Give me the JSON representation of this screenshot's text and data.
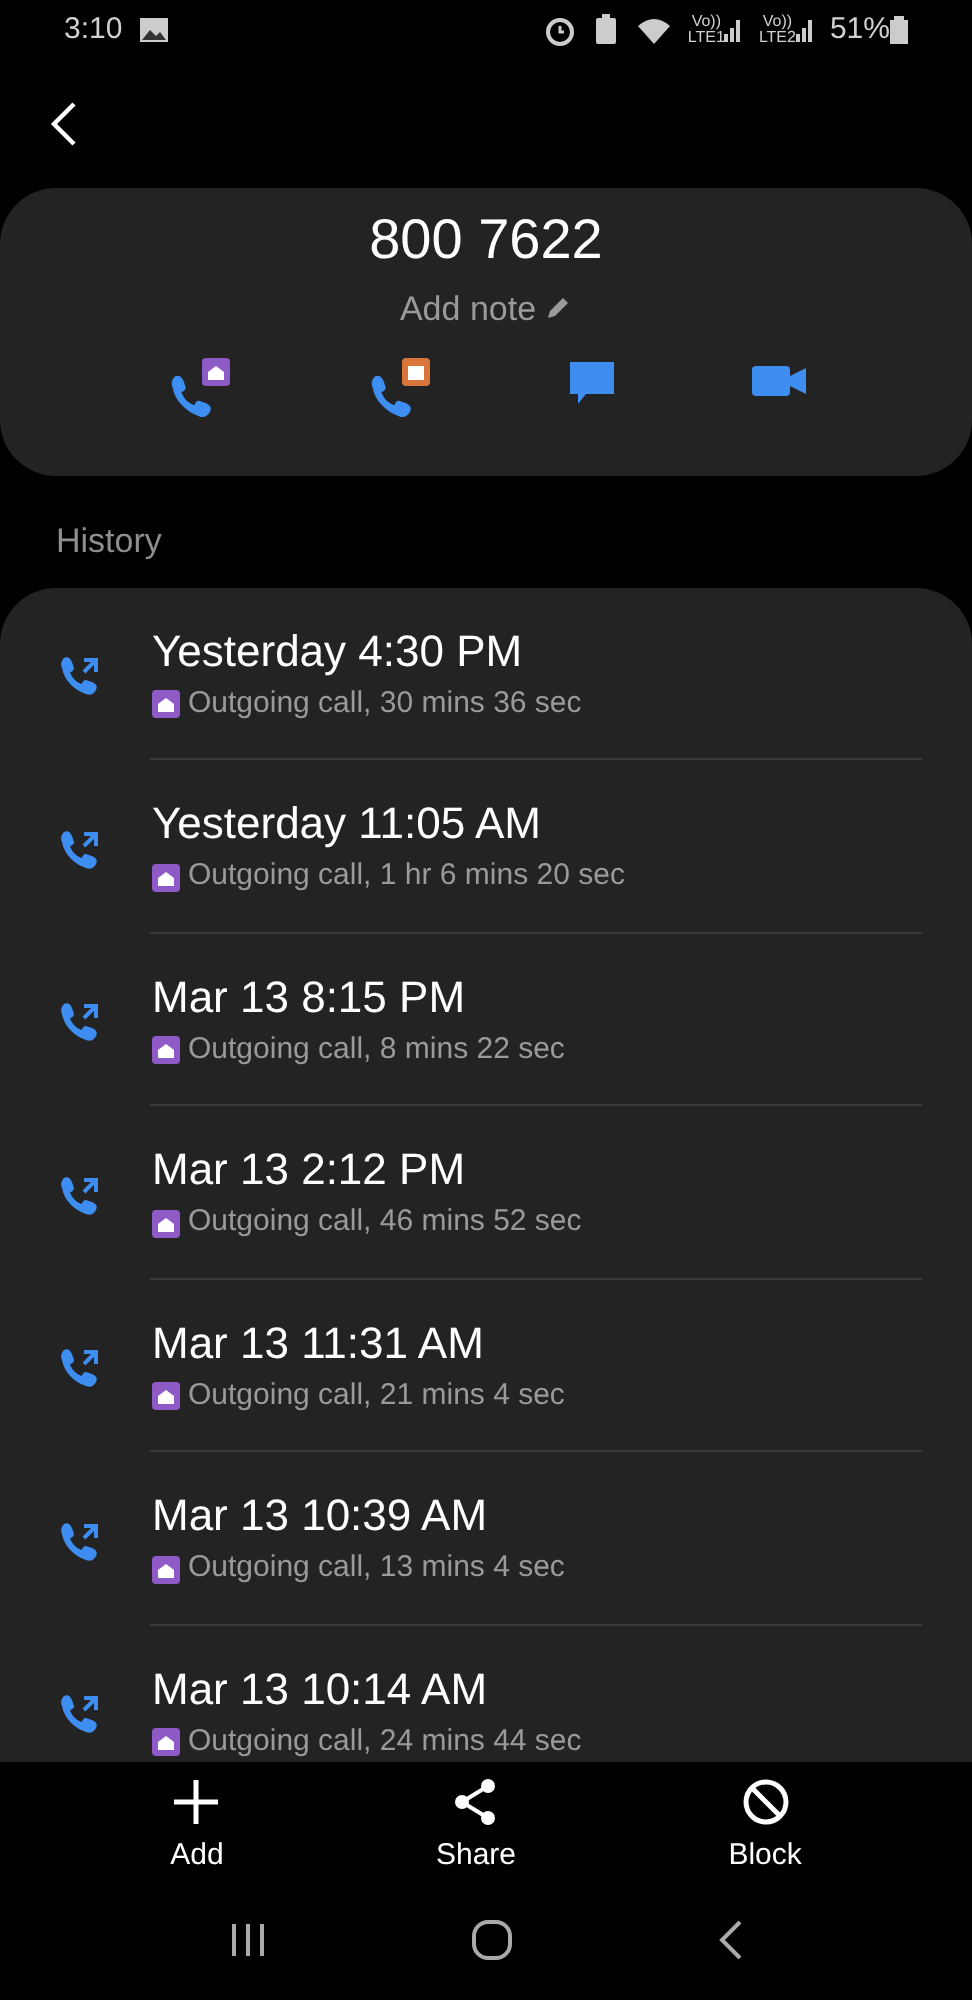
{
  "status_bar": {
    "time": "3:10",
    "sims": [
      {
        "volte": "Vo))",
        "network": "LTE1"
      },
      {
        "volte": "Vo))",
        "network": "LTE2"
      }
    ],
    "battery": "51%"
  },
  "contact": {
    "number": "800 7622",
    "note_placeholder": "Add note"
  },
  "actions": [
    {
      "kind": "call_home"
    },
    {
      "kind": "call_work"
    },
    {
      "kind": "message"
    },
    {
      "kind": "video"
    }
  ],
  "history": {
    "title": "History",
    "rows": [
      {
        "time": "Yesterday 4:30 PM",
        "detail": "Outgoing call, 30 mins 36 sec"
      },
      {
        "time": "Yesterday 11:05 AM",
        "detail": "Outgoing call, 1 hr 6 mins 20 sec"
      },
      {
        "time": "Mar 13 8:15 PM",
        "detail": "Outgoing call, 8 mins 22 sec"
      },
      {
        "time": "Mar 13 2:12 PM",
        "detail": "Outgoing call, 46 mins 52 sec"
      },
      {
        "time": "Mar 13 11:31 AM",
        "detail": "Outgoing call, 21 mins 4 sec"
      },
      {
        "time": "Mar 13 10:39 AM",
        "detail": "Outgoing call, 13 mins 4 sec"
      },
      {
        "time": "Mar 13 10:14 AM",
        "detail": "Outgoing call, 24 mins 44 sec"
      }
    ]
  },
  "bottom_actions": [
    {
      "kind": "add",
      "label": "Add"
    },
    {
      "kind": "share",
      "label": "Share"
    },
    {
      "kind": "block",
      "label": "Block"
    }
  ]
}
